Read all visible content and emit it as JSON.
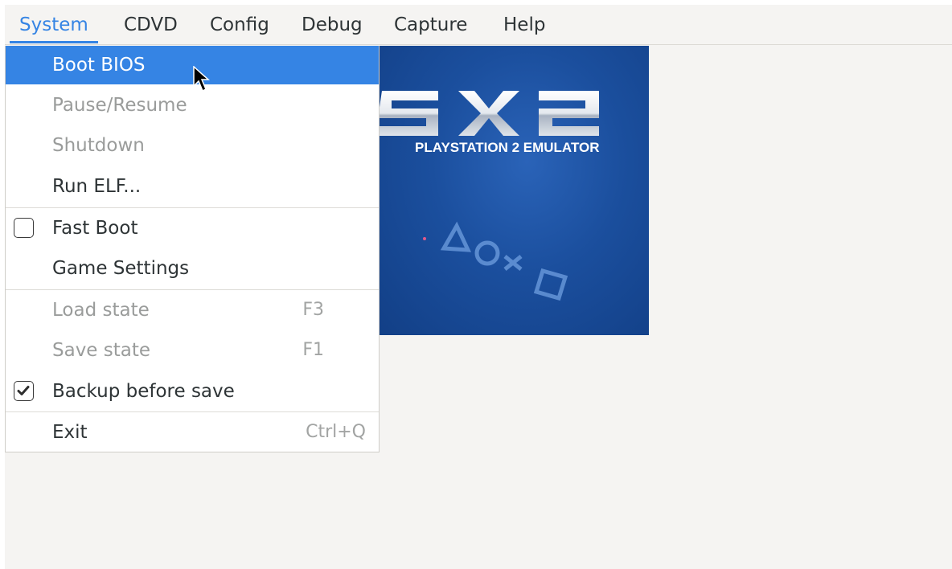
{
  "menubar": {
    "items": [
      {
        "label": "System",
        "active": true
      },
      {
        "label": "CDVD"
      },
      {
        "label": "Config"
      },
      {
        "label": "Debug"
      },
      {
        "label": "Capture"
      },
      {
        "label": "Help"
      }
    ]
  },
  "logo": {
    "wordmark": "SX2",
    "subtitle": "PLAYSTATION 2 EMULATOR",
    "icon": "ps-shapes-icon"
  },
  "system_menu": {
    "items": [
      {
        "label": "Boot BIOS",
        "state": "highlighted"
      },
      {
        "label": "Pause/Resume",
        "state": "disabled"
      },
      {
        "label": "Shutdown",
        "state": "disabled"
      },
      {
        "label": "Run ELF...",
        "state": "enabled"
      },
      {
        "label": "Fast Boot",
        "state": "enabled",
        "checkbox": "unchecked"
      },
      {
        "label": "Game Settings",
        "state": "enabled"
      },
      {
        "label": "Load state",
        "state": "disabled",
        "shortcut": "F3"
      },
      {
        "label": "Save state",
        "state": "disabled",
        "shortcut": "F1"
      },
      {
        "label": "Backup before save",
        "state": "enabled",
        "checkbox": "checked"
      },
      {
        "label": "Exit",
        "state": "enabled",
        "shortcut": "Ctrl+Q"
      }
    ]
  },
  "colors": {
    "accent": "#3584e4",
    "logo_blue": "#1b4f9e",
    "disabled_text": "#9a9c9b"
  }
}
